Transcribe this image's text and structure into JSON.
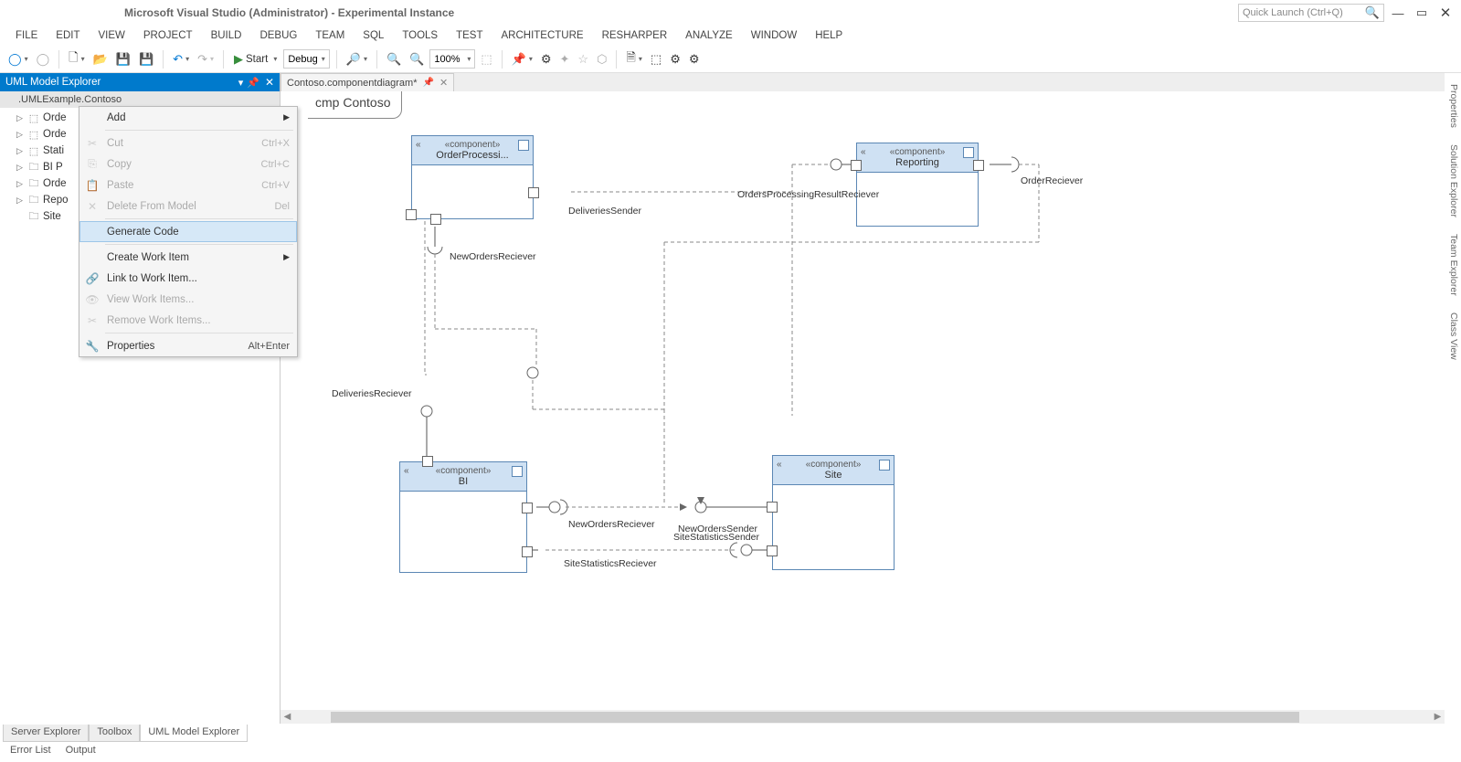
{
  "window": {
    "title": "Microsoft Visual Studio (Administrator) - Experimental Instance",
    "quicklaunch_placeholder": "Quick Launch (Ctrl+Q)"
  },
  "menu": [
    "FILE",
    "EDIT",
    "VIEW",
    "PROJECT",
    "BUILD",
    "DEBUG",
    "TEAM",
    "SQL",
    "TOOLS",
    "TEST",
    "ARCHITECTURE",
    "RESHARPER",
    "ANALYZE",
    "WINDOW",
    "HELP"
  ],
  "toolbar": {
    "start_label": "Start",
    "config_label": "Debug",
    "zoom_label": "100%"
  },
  "panel": {
    "title": "UML Model Explorer",
    "subtitle": ".UMLExample.Contoso",
    "tree_items": [
      "Orde",
      "Orde",
      "Stati",
      "BI P",
      "Orde",
      "Repo",
      "Site"
    ]
  },
  "context_menu": {
    "add": "Add",
    "cut": {
      "label": "Cut",
      "sc": "Ctrl+X"
    },
    "copy": {
      "label": "Copy",
      "sc": "Ctrl+C"
    },
    "paste": {
      "label": "Paste",
      "sc": "Ctrl+V"
    },
    "delete_model": {
      "label": "Delete From Model",
      "sc": "Del"
    },
    "generate_code": "Generate Code",
    "create_work_item": "Create Work Item",
    "link_work_item": "Link to Work Item...",
    "view_work_items": "View Work Items...",
    "remove_work_items": "Remove Work Items...",
    "properties": {
      "label": "Properties",
      "sc": "Alt+Enter"
    }
  },
  "tabs": {
    "document": "Contoso.componentdiagram*"
  },
  "diagram": {
    "title": "cmp Contoso",
    "stereotype": "«component»",
    "components": {
      "order_processing": "OrderProcessi...",
      "reporting": "Reporting",
      "bi": "BI",
      "site": "Site"
    },
    "labels": {
      "deliveries_sender": "DeliveriesSender",
      "orders_processing_result_reciever": "OrdersProcessingResultReciever",
      "order_reciever": "OrderReciever",
      "new_orders_reciever": "NewOrdersReciever",
      "deliveries_reciever": "DeliveriesReciever",
      "new_orders_reciever2": "NewOrdersReciever",
      "new_orders_sender": "NewOrdersSender",
      "site_statistics_sender": "SiteStatisticsSender",
      "site_statistics_reciever": "SiteStatisticsReciever"
    }
  },
  "bottom_tabs": [
    "Server Explorer",
    "Toolbox",
    "UML Model Explorer"
  ],
  "right_tabs": [
    "Properties",
    "Solution Explorer",
    "Team Explorer",
    "Class View"
  ],
  "output_tabs": [
    "Error List",
    "Output"
  ]
}
